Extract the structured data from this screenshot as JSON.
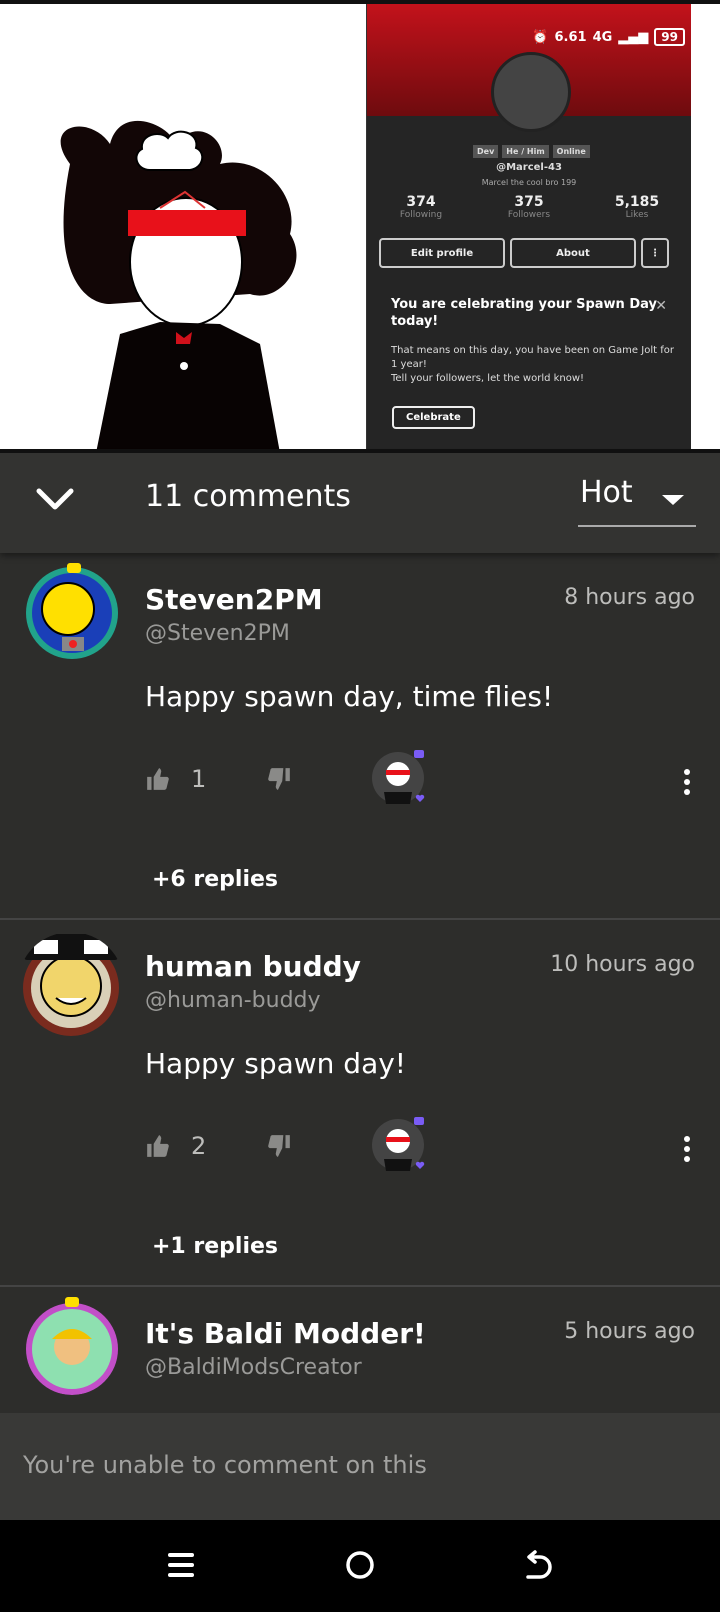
{
  "post_image": {
    "status_bar": {
      "speed": "6.61",
      "network": "4G",
      "battery": "99"
    },
    "profile": {
      "badges": [
        "Dev",
        "He / Him",
        "Online"
      ],
      "handle": "@Marcel-43",
      "bio": "Marcel the cool bro 199",
      "stats": [
        {
          "value": "374",
          "label": "Following"
        },
        {
          "value": "375",
          "label": "Followers"
        },
        {
          "value": "5,185",
          "label": "Likes"
        }
      ],
      "edit_button": "Edit profile",
      "about_button": "About",
      "banner_color": "#c3121b"
    },
    "celebration": {
      "title": "You are celebrating your Spawn Day today!",
      "line1": "That means on this day, you have been on Game Jolt for 1 year!",
      "line2": "Tell your followers, let the world know!",
      "button": "Celebrate"
    }
  },
  "header": {
    "count_label": "11 comments",
    "sort_label": "Hot"
  },
  "comments": [
    {
      "name": "Steven2PM",
      "handle": "@Steven2PM",
      "time": "8 hours ago",
      "body": "Happy spawn day, time flies!",
      "likes": "1",
      "replies": "+6 replies"
    },
    {
      "name": "human buddy",
      "handle": "@human-buddy",
      "time": "10 hours ago",
      "body": "Happy spawn day!",
      "likes": "2",
      "replies": "+1 replies"
    },
    {
      "name": "It's Baldi Modder!",
      "handle": "@BaldiModsCreator",
      "time": "5 hours ago"
    }
  ],
  "composer": {
    "placeholder": "You're unable to comment on this"
  },
  "colors": {
    "background": "#2d2d2b",
    "accent_purple": "#7a5cf5"
  }
}
